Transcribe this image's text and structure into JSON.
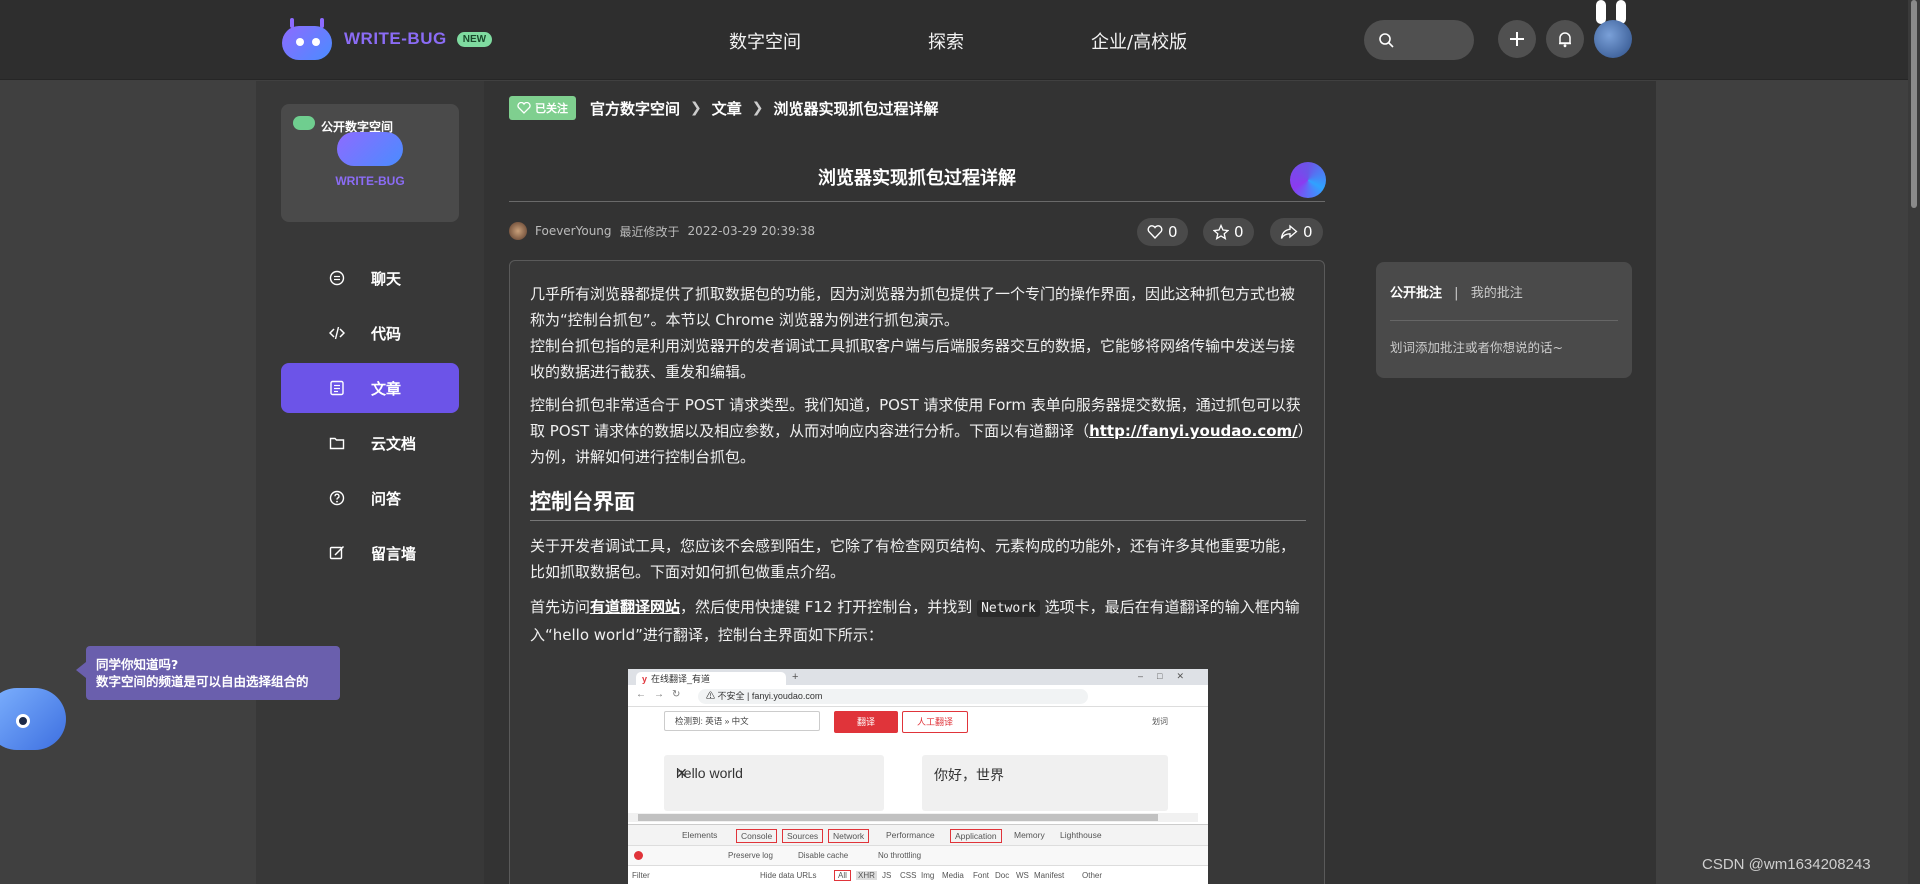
{
  "brand": {
    "name": "WRITE-BUG",
    "badge": "NEW"
  },
  "nav": {
    "items": [
      "数字空间",
      "探索",
      "企业/高校版"
    ]
  },
  "sidebar": {
    "space_label": "公开数字空间",
    "space_brand": "WRITE-BUG",
    "items": [
      {
        "label": "聊天",
        "icon": "chat-icon"
      },
      {
        "label": "代码",
        "icon": "code-icon"
      },
      {
        "label": "文章",
        "icon": "article-icon",
        "active": true
      },
      {
        "label": "云文档",
        "icon": "folder-icon"
      },
      {
        "label": "问答",
        "icon": "question-icon"
      },
      {
        "label": "留言墙",
        "icon": "edit-icon"
      }
    ]
  },
  "tip": {
    "line1": "同学你知道吗?",
    "line2": "数字空间的频道是可以自由选择组合的"
  },
  "breadcrumb": {
    "follow": "已关注",
    "items": [
      "官方数字空间",
      "文章",
      "浏览器实现抓包过程详解"
    ]
  },
  "article": {
    "title": "浏览器实现抓包过程详解",
    "author": "FoeverYoung",
    "modified_label": "最近修改于",
    "modified": "2022-03-29 20:39:38",
    "likes": "0",
    "stars": "0",
    "shares": "0",
    "p1a": "几乎所有浏览器都提供了抓取数据包的功能，因为浏览器为抓包提供了一个专门的操作界面，因此这种抓包方式也被称为“控制台抓包”。本节以 Chrome 浏览器为例进行抓包演示。",
    "p1b": "控制台抓包指的是利用浏览器开的发者调试工具抓取客户端与后端服务器交互的数据，它能够将网络传输中发送与接收的数据进行截获、重发和编辑。",
    "p2_pre": "控制台抓包非常适合于 POST 请求类型。我们知道，POST 请求使用 Form 表单向服务器提交数据，通过抓包可以获取 POST 请求体的数据以及相应参数，从而对响应内容进行分析。下面以有道翻译（",
    "p2_link": "http://fanyi.youdao.com/",
    "p2_post": "）为例，讲解如何进行控制台抓包。",
    "h2": "控制台界面",
    "p3": "关于开发者调试工具，您应该不会感到陌生，它除了有检查网页结构、元素构成的功能外，还有许多其他重要功能，比如抓取数据包。下面对如何抓包做重点介绍。",
    "p4_pre": "首先访问",
    "p4_link": "有道翻译网站",
    "p4_mid": "，然后使用快捷键 F12 打开控制台，并找到 ",
    "p4_code": "Network",
    "p4_post": " 选项卡，最后在有道翻译的输入框内输入“hello world”进行翻译，控制台主界面如下所示："
  },
  "screenshot": {
    "tab_title": "在线翻译_有道",
    "url_prefix": "不安全",
    "url": "fanyi.youdao.com",
    "lang": "检测到: 英语 » 中文",
    "translate_btn": "翻译",
    "human_btn": "人工翻译",
    "hint": "划词",
    "input_text": "hello world",
    "output_text": "你好，世界",
    "devtabs": [
      "Elements",
      "Console",
      "Sources",
      "Network",
      "Performance",
      "Application",
      "Memory",
      "Lighthouse"
    ],
    "row2": [
      "Preserve log",
      "Disable cache",
      "No throttling"
    ],
    "filter_placeholder": "Filter",
    "filter_items": [
      "Hide data URLs",
      "All",
      "XHR",
      "JS",
      "CSS",
      "Img",
      "Media",
      "Font",
      "Doc",
      "WS",
      "Manifest",
      "Other"
    ]
  },
  "annotation": {
    "tab_public": "公开批注",
    "divider": "|",
    "tab_mine": "我的批注",
    "placeholder": "划词添加批注或者你想说的话~"
  },
  "watermark": "CSDN @wm1634208243",
  "colors": {
    "accent": "#6c54e8",
    "follow": "#7fcf8f",
    "red": "#e0343a"
  }
}
